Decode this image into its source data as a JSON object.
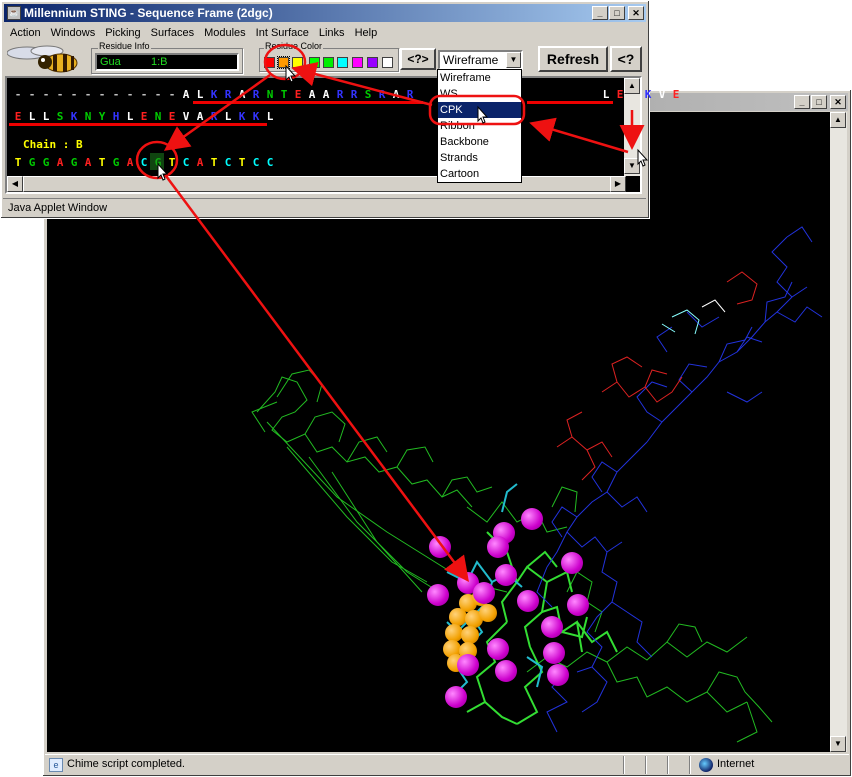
{
  "chime_window": {
    "status": "Chime script completed.",
    "zone": "Internet"
  },
  "seq_window": {
    "title": "Millennium STING - Sequence Frame (2dgc)",
    "menus": [
      "Action",
      "Windows",
      "Picking",
      "Surfaces",
      "Modules",
      "Int Surface",
      "Links",
      "Help"
    ],
    "residue_info_label": "Residue Info",
    "residue_name": "Gua",
    "residue_id": "1:B",
    "residue_color_label": "Residue Color",
    "help_button": "<?>",
    "render_select_value": "Wireframe",
    "refresh_button": "Refresh",
    "help_button_2": "<?",
    "chain_label": "Chain : B",
    "status": "Java Applet Window",
    "palette": [
      "#ff0000",
      "#ff9900",
      "#ffff00",
      "#00ff00",
      "#00ff00",
      "#00ffff",
      "#0000ff",
      "#ff00ff",
      "#9900ff",
      "#ffffff"
    ]
  },
  "dropdown": {
    "options": [
      "Wireframe",
      "WS",
      "CPK",
      "Ribbon",
      "Backbone",
      "Strands",
      "Cartoon"
    ],
    "highlighted": "CPK"
  },
  "sequence": {
    "line1": [
      {
        "t": "-",
        "c": "#c0c0c0"
      },
      {
        "t": "-",
        "c": "#c0c0c0"
      },
      {
        "t": "-",
        "c": "#c0c0c0"
      },
      {
        "t": "-",
        "c": "#c0c0c0"
      },
      {
        "t": "-",
        "c": "#c0c0c0"
      },
      {
        "t": "-",
        "c": "#c0c0c0"
      },
      {
        "t": "-",
        "c": "#c0c0c0"
      },
      {
        "t": "-",
        "c": "#c0c0c0"
      },
      {
        "t": "-",
        "c": "#c0c0c0"
      },
      {
        "t": "-",
        "c": "#c0c0c0"
      },
      {
        "t": "-",
        "c": "#c0c0c0"
      },
      {
        "t": "-",
        "c": "#c0c0c0"
      },
      {
        "t": "A",
        "c": "#ffffff"
      },
      {
        "t": "L",
        "c": "#ffffff"
      },
      {
        "t": "K",
        "c": "#3333ff"
      },
      {
        "t": "R",
        "c": "#3333ff"
      },
      {
        "t": "A",
        "c": "#ffffff"
      },
      {
        "t": "R",
        "c": "#3333ff"
      },
      {
        "t": "N",
        "c": "#00cc00"
      },
      {
        "t": "T",
        "c": "#00cc00"
      },
      {
        "t": "E",
        "c": "#ff2020"
      },
      {
        "t": "A",
        "c": "#ffffff"
      },
      {
        "t": "A",
        "c": "#ffffff"
      },
      {
        "t": "R",
        "c": "#3333ff"
      },
      {
        "t": "R",
        "c": "#3333ff"
      },
      {
        "t": "S",
        "c": "#00cc00"
      },
      {
        "t": "R",
        "c": "#3333ff"
      },
      {
        "t": "A",
        "c": "#ffffff"
      },
      {
        "t": "R",
        "c": "#3333ff"
      },
      {
        "t": " ",
        "c": "#000"
      },
      {
        "t": " ",
        "c": "#000"
      },
      {
        "t": " ",
        "c": "#000"
      },
      {
        "t": " ",
        "c": "#000"
      },
      {
        "t": " ",
        "c": "#000"
      },
      {
        "t": " ",
        "c": "#000"
      },
      {
        "t": " ",
        "c": "#000"
      },
      {
        "t": " ",
        "c": "#000"
      },
      {
        "t": " ",
        "c": "#000"
      },
      {
        "t": " ",
        "c": "#000"
      },
      {
        "t": " ",
        "c": "#000"
      },
      {
        "t": " ",
        "c": "#000"
      },
      {
        "t": " ",
        "c": "#000"
      },
      {
        "t": "L",
        "c": "#ffffff"
      },
      {
        "t": "E",
        "c": "#ff2020"
      },
      {
        "t": "D",
        "c": "#ff2020"
      },
      {
        "t": "K",
        "c": "#3333ff"
      },
      {
        "t": "V",
        "c": "#ffffff"
      },
      {
        "t": "E",
        "c": "#ff2020"
      }
    ],
    "line2": [
      {
        "t": "E",
        "c": "#ff2020"
      },
      {
        "t": "L",
        "c": "#ffffff"
      },
      {
        "t": "L",
        "c": "#ffffff"
      },
      {
        "t": "S",
        "c": "#00cc00"
      },
      {
        "t": "K",
        "c": "#3333ff"
      },
      {
        "t": "N",
        "c": "#00cc00"
      },
      {
        "t": "Y",
        "c": "#00cc00"
      },
      {
        "t": "H",
        "c": "#3333ff"
      },
      {
        "t": "L",
        "c": "#ffffff"
      },
      {
        "t": "E",
        "c": "#ff2020"
      },
      {
        "t": "N",
        "c": "#00cc00"
      },
      {
        "t": "E",
        "c": "#ff2020"
      },
      {
        "t": "V",
        "c": "#ffffff"
      },
      {
        "t": "A",
        "c": "#ffffff"
      },
      {
        "t": "R",
        "c": "#3333ff"
      },
      {
        "t": "L",
        "c": "#ffffff"
      },
      {
        "t": "K",
        "c": "#3333ff"
      },
      {
        "t": "K",
        "c": "#3333ff"
      },
      {
        "t": "L",
        "c": "#ffffff"
      }
    ],
    "line3": [
      {
        "t": "T",
        "c": "#ffff00"
      },
      {
        "t": "G",
        "c": "#00cc00"
      },
      {
        "t": "G",
        "c": "#00cc00"
      },
      {
        "t": "A",
        "c": "#ff2020"
      },
      {
        "t": "G",
        "c": "#00cc00"
      },
      {
        "t": "A",
        "c": "#ff2020"
      },
      {
        "t": "T",
        "c": "#ffff00"
      },
      {
        "t": "G",
        "c": "#00cc00"
      },
      {
        "t": "A",
        "c": "#ff2020"
      },
      {
        "t": "C",
        "c": "#00ffff"
      },
      {
        "t": "G",
        "c": "#00cc00"
      },
      {
        "t": "T",
        "c": "#ffff00"
      },
      {
        "t": "C",
        "c": "#00ffff"
      },
      {
        "t": "A",
        "c": "#ff2020"
      },
      {
        "t": "T",
        "c": "#ffff00"
      },
      {
        "t": "C",
        "c": "#00ffff"
      },
      {
        "t": "T",
        "c": "#ffff00"
      },
      {
        "t": "C",
        "c": "#00ffff"
      },
      {
        "t": "C",
        "c": "#00ffff"
      }
    ]
  }
}
